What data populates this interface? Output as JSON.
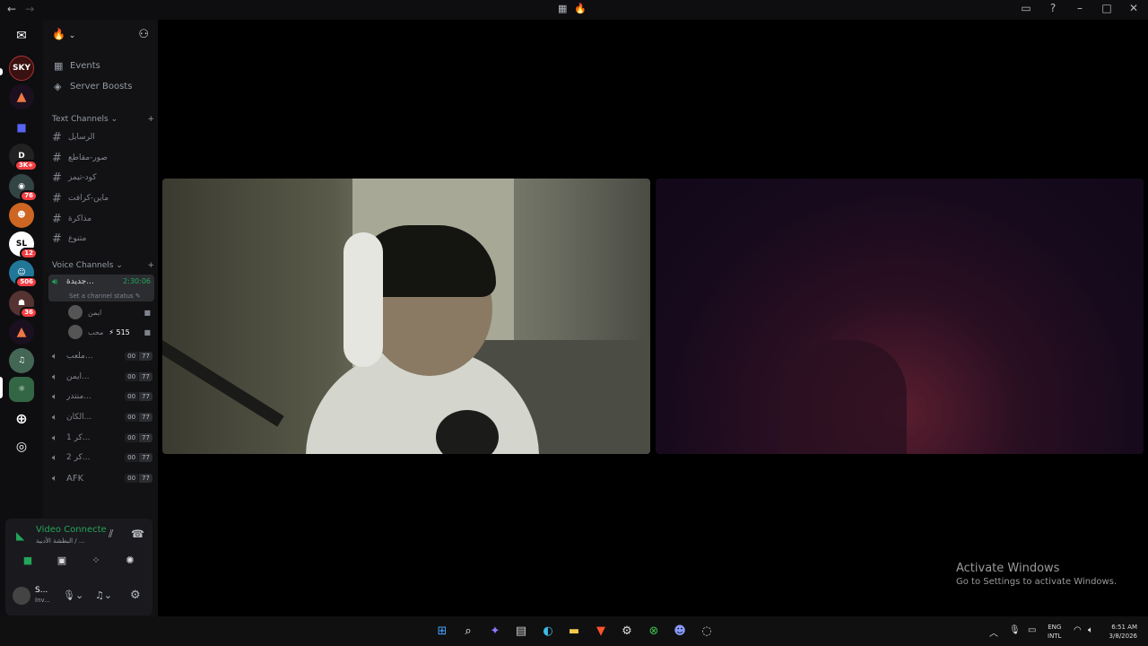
{
  "sidebar": {
    "server_name_emoji": "🔥",
    "events_label": "Events",
    "boosts_label": "Server Boosts",
    "text_category": "Text Channels",
    "voice_category": "Voice Channels",
    "text_channels": [
      "الرسايل",
      "صور-مقاطع",
      "كود-تيمز",
      "ماين-كرافت",
      "مذاكرة",
      "متنوع"
    ],
    "active_voice": {
      "name": "جديدة...",
      "timer": "2:30:06",
      "status_hint": "Set a channel status"
    },
    "voice_users": [
      {
        "name": "ايمن"
      },
      {
        "name": "محب",
        "extra": "515"
      }
    ],
    "voice_channels": [
      {
        "name": "ملعب...",
        "a": "00",
        "b": "77"
      },
      {
        "name": "ايمن...",
        "a": "00",
        "b": "77"
      },
      {
        "name": "منتدر...",
        "a": "00",
        "b": "77"
      },
      {
        "name": "الكان...",
        "a": "00",
        "b": "77"
      },
      {
        "name": "1 كر...",
        "a": "00",
        "b": "77"
      },
      {
        "name": "2 كر...",
        "a": "00",
        "b": "77"
      },
      {
        "name": "AFK",
        "a": "00",
        "b": "77"
      }
    ]
  },
  "rail_badges": [
    "3K+",
    "76",
    "12",
    "506",
    "36"
  ],
  "voice_panel": {
    "status": "Video Connecte",
    "sub": "البطشة الأدبية / ...",
    "user_name": "S...",
    "user_sub": "Inv..."
  },
  "watermark": {
    "title": "Activate Windows",
    "sub": "Go to Settings to activate Windows."
  },
  "taskbar": {
    "lang": "ENG",
    "layout": "INTL",
    "time": "6:51 AM",
    "date": "3/8/2026"
  },
  "icons": [
    "discord-icon",
    "search-icon",
    "windows-start-icon",
    "edge-icon",
    "folder-icon",
    "brave-icon",
    "steam-icon",
    "xbox-icon"
  ],
  "colors": {
    "accent_green": "#23a55a",
    "badge_red": "#f23f43",
    "blurple": "#5865f2"
  }
}
